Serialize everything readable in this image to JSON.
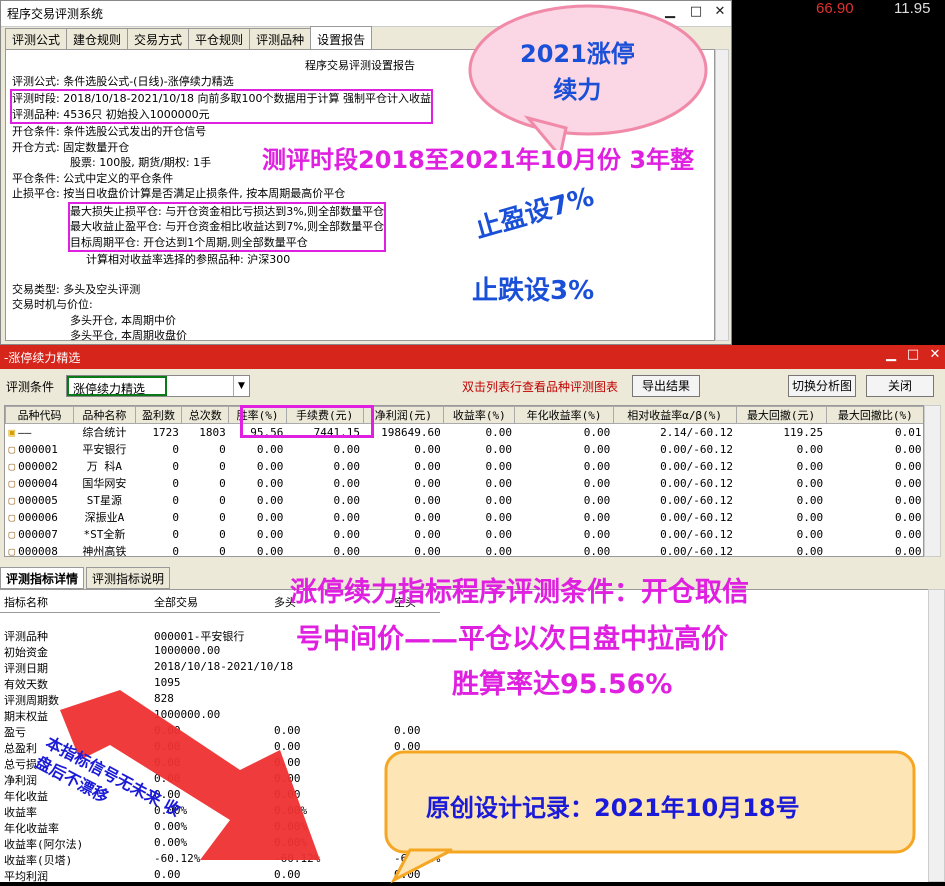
{
  "ticker": {
    "a": "66.90",
    "b": "11.95"
  },
  "report_window": {
    "title": "程序交易评测系统",
    "tabs": [
      "评测公式",
      "建仓规则",
      "交易方式",
      "平仓规则",
      "评测品种",
      "设置报告"
    ],
    "report_title": "程序交易评测设置报告",
    "lines": {
      "l1": "评测公式: 条件选股公式-(日线)-涨停续力精选",
      "l2": "评测时段: 2018/10/18-2021/10/18 向前多取100个数据用于计算 强制平仓计入收益",
      "l3": "评测品种: 4536只 初始投入1000000元",
      "l4": "开仓条件: 条件选股公式发出的开仓信号",
      "l5": "开仓方式: 固定数量开仓",
      "l6": "股票: 100股, 期货/期权: 1手",
      "l7": "平仓条件: 公式中定义的平仓条件",
      "l8": "止损平仓: 按当日收盘价计算是否满足止损条件, 按本周期最高价平仓",
      "l9": "最大损失止损平仓: 与开仓资金相比亏损达到3%,则全部数量平仓",
      "l10": "最大收益止盈平仓: 与开仓资金相比收益达到7%,则全部数量平仓",
      "l11": "目标周期平仓: 开仓达到1个周期,则全部数量平仓",
      "l12": "计算相对收益率选择的参照品种: 沪深300",
      "l13": "交易类型: 多头及空头评测",
      "l14": "交易时机与价位:",
      "l15": "多头开仓, 本周期中价",
      "l16": "多头平仓, 本周期收盘价"
    }
  },
  "list_window": {
    "title": "-涨停续力精选",
    "cond_label": "评测条件",
    "cond_value": "涨停续力精选",
    "hint": "双击列表行查看品种评测图表",
    "export_btn": "导出结果",
    "switch_btn": "切换分析图",
    "close_btn": "关闭",
    "columns": [
      "品种代码",
      "品种名称",
      "盈利数",
      "总次数",
      "胜率(%)",
      "手续费(元)",
      "净利润(元)",
      "收益率(%)",
      "年化收益率(%)",
      "相对收益率α/β(%)",
      "最大回撤(元)",
      "最大回撤比(%)"
    ],
    "rows": [
      [
        "——",
        "综合统计",
        "1723",
        "1803",
        "95.56",
        "7441.15",
        "198649.60",
        "0.00",
        "0.00",
        "2.14/-60.12",
        "119.25",
        "0.01"
      ],
      [
        "000001",
        "平安银行",
        "0",
        "0",
        "0.00",
        "0.00",
        "0.00",
        "0.00",
        "0.00",
        "0.00/-60.12",
        "0.00",
        "0.00"
      ],
      [
        "000002",
        "万 科A",
        "0",
        "0",
        "0.00",
        "0.00",
        "0.00",
        "0.00",
        "0.00",
        "0.00/-60.12",
        "0.00",
        "0.00"
      ],
      [
        "000004",
        "国华网安",
        "0",
        "0",
        "0.00",
        "0.00",
        "0.00",
        "0.00",
        "0.00",
        "0.00/-60.12",
        "0.00",
        "0.00"
      ],
      [
        "000005",
        "ST星源",
        "0",
        "0",
        "0.00",
        "0.00",
        "0.00",
        "0.00",
        "0.00",
        "0.00/-60.12",
        "0.00",
        "0.00"
      ],
      [
        "000006",
        "深振业A",
        "0",
        "0",
        "0.00",
        "0.00",
        "0.00",
        "0.00",
        "0.00",
        "0.00/-60.12",
        "0.00",
        "0.00"
      ],
      [
        "000007",
        "*ST全新",
        "0",
        "0",
        "0.00",
        "0.00",
        "0.00",
        "0.00",
        "0.00",
        "0.00/-60.12",
        "0.00",
        "0.00"
      ],
      [
        "000008",
        "神州高铁",
        "0",
        "0",
        "0.00",
        "0.00",
        "0.00",
        "0.00",
        "0.00",
        "0.00/-60.12",
        "0.00",
        "0.00"
      ]
    ],
    "detail_tabs": [
      "评测指标详情",
      "评测指标说明"
    ],
    "detail_head": [
      "指标名称",
      "全部交易",
      "多头",
      "空头"
    ],
    "detail_rows": [
      [
        "评测品种",
        "000001-平安银行",
        "",
        ""
      ],
      [
        "初始资金",
        "1000000.00",
        "",
        ""
      ],
      [
        "评测日期",
        "2018/10/18-2021/10/18",
        "",
        ""
      ],
      [
        "有效天数",
        "1095",
        "",
        ""
      ],
      [
        "评测周期数",
        "828",
        "",
        ""
      ],
      [
        "期末权益",
        "1000000.00",
        "",
        ""
      ],
      [
        "盈亏",
        "0.00",
        "0.00",
        "0.00"
      ],
      [
        "总盈利",
        "0.00",
        "0.00",
        "0.00"
      ],
      [
        "总亏损",
        "0.00",
        "0.00",
        "0.00"
      ],
      [
        "净利润",
        "0.00",
        "0.00",
        "0.00"
      ],
      [
        "年化收益",
        "0.00",
        "0.00",
        "0.00"
      ],
      [
        "收益率",
        "0.00%",
        "0.00%",
        "0.00%"
      ],
      [
        "年化收益率",
        "0.00%",
        "0.00%",
        "0.00%"
      ],
      [
        "收益率(阿尔法)",
        "0.00%",
        "0.00%",
        "0.00%"
      ],
      [
        "收益率(贝塔)",
        "-60.12%",
        "-60.12%",
        "-60.12%"
      ],
      [
        "平均利润",
        "0.00",
        "0.00",
        "0.00"
      ]
    ]
  },
  "annotations": {
    "bubble1": "2021涨停\n续力",
    "period": "测评时段2018至2021年10月份 3年整",
    "stop_profit": "止盈设7%",
    "stop_loss": "止跌设3%",
    "cond_title_1": "涨停续力指标程序评测条件：开仓取信",
    "cond_title_2": "号中间价——平仓以次日盘中拉高价",
    "cond_title_3": "胜算率达95.56%",
    "arrow_text": "本指标信号无未来 收\n盘后不漂移",
    "record": "原创设计记录：2021年10月18号"
  },
  "colors": {
    "magenta": "#e020e0",
    "blue": "#1a4fd8",
    "red": "#d6261c",
    "green": "#0a7a18"
  }
}
